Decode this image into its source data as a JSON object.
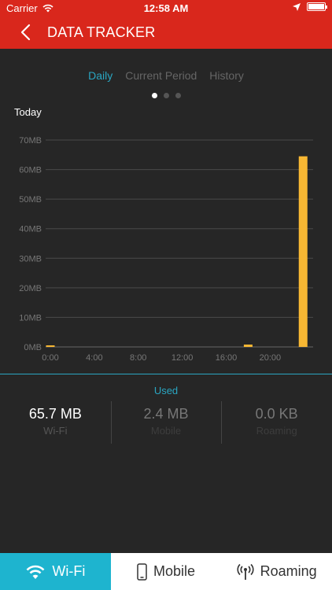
{
  "status": {
    "carrier": "Carrier",
    "time": "12:58 AM"
  },
  "nav": {
    "title": "DATA TRACKER"
  },
  "tabs": [
    {
      "label": "Daily",
      "active": true
    },
    {
      "label": "Current Period",
      "active": false
    },
    {
      "label": "History",
      "active": false
    }
  ],
  "chart_data": {
    "type": "bar",
    "title": "Today",
    "x": [
      "0:00",
      "4:00",
      "8:00",
      "12:00",
      "16:00",
      "20:00"
    ],
    "ylim": [
      0,
      70
    ],
    "y_ticks": [
      "0MB",
      "10MB",
      "20MB",
      "30MB",
      "40MB",
      "50MB",
      "60MB",
      "70MB"
    ],
    "grid": true,
    "bars": [
      {
        "hour": 0,
        "value": 0.3
      },
      {
        "hour": 18,
        "value": 0.8
      },
      {
        "hour": 23,
        "value": 64.5
      }
    ],
    "bar_color": "#f7b733"
  },
  "usage": {
    "heading": "Used",
    "items": [
      {
        "value": "65.7 MB",
        "label": "Wi-Fi"
      },
      {
        "value": "2.4 MB",
        "label": "Mobile"
      },
      {
        "value": "0.0 KB",
        "label": "Roaming"
      }
    ]
  },
  "bottom_tabs": [
    {
      "label": "Wi-Fi",
      "icon": "wifi-icon",
      "active": true
    },
    {
      "label": "Mobile",
      "icon": "phone-icon",
      "active": false
    },
    {
      "label": "Roaming",
      "icon": "antenna-icon",
      "active": false
    }
  ],
  "colors": {
    "brand": "#d9271c",
    "accent": "#1eb4cf",
    "bar": "#f7b733"
  }
}
